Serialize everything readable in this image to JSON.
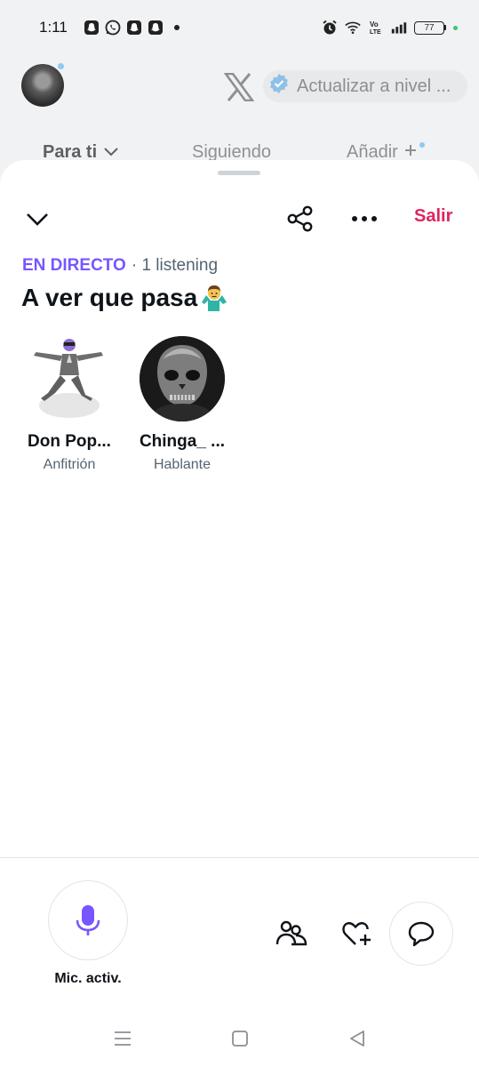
{
  "status_bar": {
    "time": "1:11",
    "battery_level": "77",
    "notification_icons": [
      "snapchat-icon",
      "whatsapp-icon",
      "snapchat-icon",
      "snapchat-icon",
      "dot-icon"
    ],
    "system_icons": [
      "alarm-icon",
      "wifi-icon",
      "volte-icon",
      "signal-icon",
      "battery-icon"
    ]
  },
  "background_header": {
    "upgrade_label": "Actualizar a nivel ...",
    "tabs": [
      {
        "label": "Para ti",
        "active": true
      },
      {
        "label": "Siguiendo",
        "active": false
      },
      {
        "label": "Añadir",
        "active": false
      }
    ]
  },
  "space": {
    "leave_label": "Salir",
    "live_label": "EN DIRECTO",
    "listening_text": "· 1 listening",
    "title": "A ver que pasa",
    "participants": [
      {
        "name": "Don Pop...",
        "role": "Anfitrión"
      },
      {
        "name": "Chinga_ ...",
        "role": "Hablante"
      }
    ]
  },
  "controls": {
    "mic_label": "Mic. activ."
  },
  "colors": {
    "live": "#7856ff",
    "leave": "#e0245e",
    "mic": "#7856ff",
    "verified": "#1d9bf0"
  }
}
